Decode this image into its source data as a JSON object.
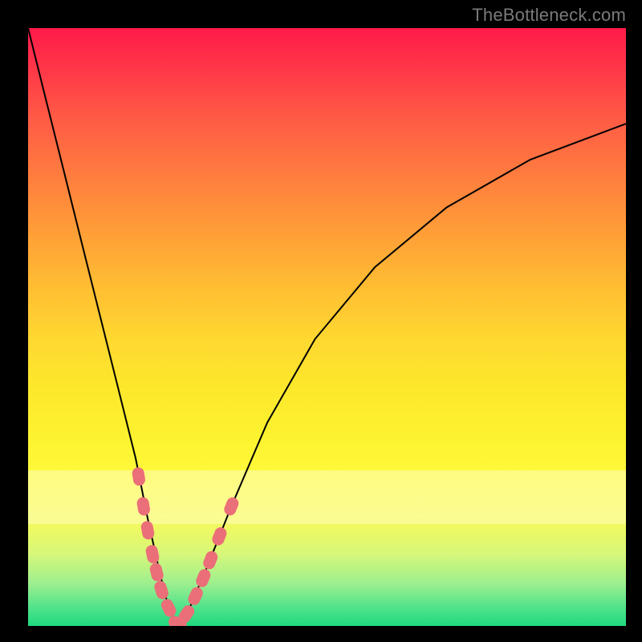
{
  "watermark": {
    "text": "TheBottleneck.com"
  },
  "chart_data": {
    "type": "line",
    "title": "",
    "xlabel": "",
    "ylabel": "",
    "xlim": [
      0,
      100
    ],
    "ylim": [
      0,
      100
    ],
    "grid": false,
    "legend": false,
    "series": [
      {
        "name": "bottleneck-curve",
        "x": [
          0,
          3,
          6,
          9,
          12,
          15,
          18,
          20,
          22,
          23.5,
          25,
          27,
          30,
          34,
          40,
          48,
          58,
          70,
          84,
          100
        ],
        "y": [
          100,
          88,
          76,
          64,
          52,
          40,
          28,
          18,
          9,
          3,
          0,
          3,
          10,
          20,
          34,
          48,
          60,
          70,
          78,
          84
        ]
      }
    ],
    "markers": {
      "name": "highlighted-points",
      "color": "#eb6f78",
      "points": [
        {
          "x": 18.5,
          "y": 25
        },
        {
          "x": 19.3,
          "y": 20
        },
        {
          "x": 20.0,
          "y": 16
        },
        {
          "x": 20.8,
          "y": 12
        },
        {
          "x": 21.5,
          "y": 9
        },
        {
          "x": 22.3,
          "y": 6
        },
        {
          "x": 23.5,
          "y": 3
        },
        {
          "x": 25.0,
          "y": 0.5
        },
        {
          "x": 26.5,
          "y": 2
        },
        {
          "x": 28.0,
          "y": 5
        },
        {
          "x": 29.3,
          "y": 8
        },
        {
          "x": 30.5,
          "y": 11
        },
        {
          "x": 32.0,
          "y": 15
        },
        {
          "x": 34.0,
          "y": 20
        }
      ]
    },
    "background_gradient": {
      "top": "#ff1a49",
      "bottom": "#1fd97f",
      "description": "red-to-green vertical gradient (bottleneck severity)"
    }
  }
}
